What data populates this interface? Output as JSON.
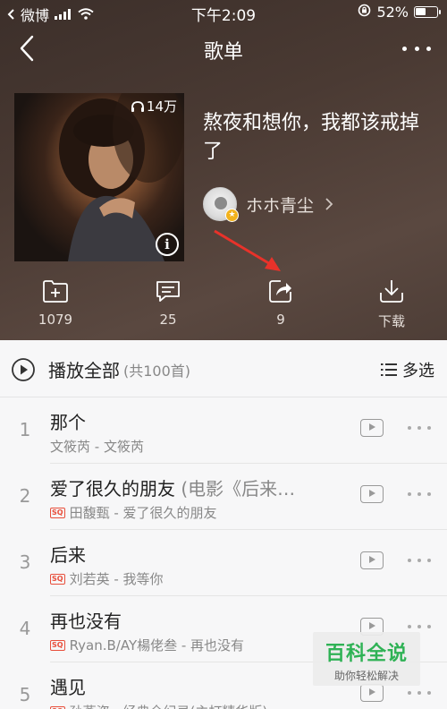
{
  "status_bar": {
    "carrier": "微博",
    "time": "下午2:09",
    "battery": "52%",
    "battery_level": 0.52
  },
  "nav": {
    "title": "歌单",
    "back_icon": "chevron-left-icon",
    "more_icon": "more-horizontal-icon"
  },
  "playlist": {
    "play_count": "14万",
    "title": "熬夜和想你，我都该戒掉了",
    "creator": "ホホ青尘"
  },
  "actions": [
    {
      "icon": "add-folder-icon",
      "label": "1079"
    },
    {
      "icon": "comment-icon",
      "label": "25"
    },
    {
      "icon": "share-icon",
      "label": "9"
    },
    {
      "icon": "download-icon",
      "label": "下载"
    }
  ],
  "play_all": {
    "label": "播放全部",
    "count": "(共100首)",
    "multi_select": "多选"
  },
  "songs": [
    {
      "num": "1",
      "title": "那个",
      "alias": "",
      "sq": false,
      "meta": "文筱芮 - 文筱芮"
    },
    {
      "num": "2",
      "title": "爱了很久的朋友",
      "alias": " (电影《后来…",
      "sq": true,
      "meta": "田馥甄 - 爱了很久的朋友"
    },
    {
      "num": "3",
      "title": "后来",
      "alias": "",
      "sq": true,
      "meta": "刘若英 - 我等你"
    },
    {
      "num": "4",
      "title": "再也没有",
      "alias": "",
      "sq": true,
      "meta": "Ryan.B/AY楊佬叁 - 再也没有"
    },
    {
      "num": "5",
      "title": "遇见",
      "alias": "",
      "sq": true,
      "meta": "孙燕姿 - 经典全纪录(主打精华版)"
    }
  ],
  "sq_label": "SQ",
  "watermark": {
    "main": "百科全说",
    "sub": "助你轻松解决"
  },
  "colors": {
    "header_bg": "#4a3a33",
    "annotation_arrow": "#e8322a",
    "sq_badge": "#e84e3b",
    "watermark_green": "#2fb255"
  }
}
